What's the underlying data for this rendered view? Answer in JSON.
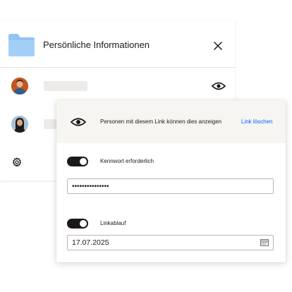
{
  "panel": {
    "title": "Persönliche Informationen",
    "icons": {
      "folder": "folder-icon",
      "close": "close-icon",
      "settings": "gear-icon",
      "visibility": "eye-icon"
    }
  },
  "colors": {
    "folder": "#8fc4f3",
    "accent": "#0061fe",
    "toggle_on": "#1e1919",
    "header_bg": "#f7f5f2"
  },
  "share_settings": {
    "visibility_text": "Personen mit diesem Link können dies anzeigen",
    "delete_link": "Link löschen",
    "password": {
      "label": "Kennwort erforderlich",
      "enabled": true,
      "value": "•••••••••••••••"
    },
    "expiry": {
      "label": "Linkablauf",
      "enabled": true,
      "date": "17.07.2025",
      "icon": "calendar-icon"
    }
  }
}
